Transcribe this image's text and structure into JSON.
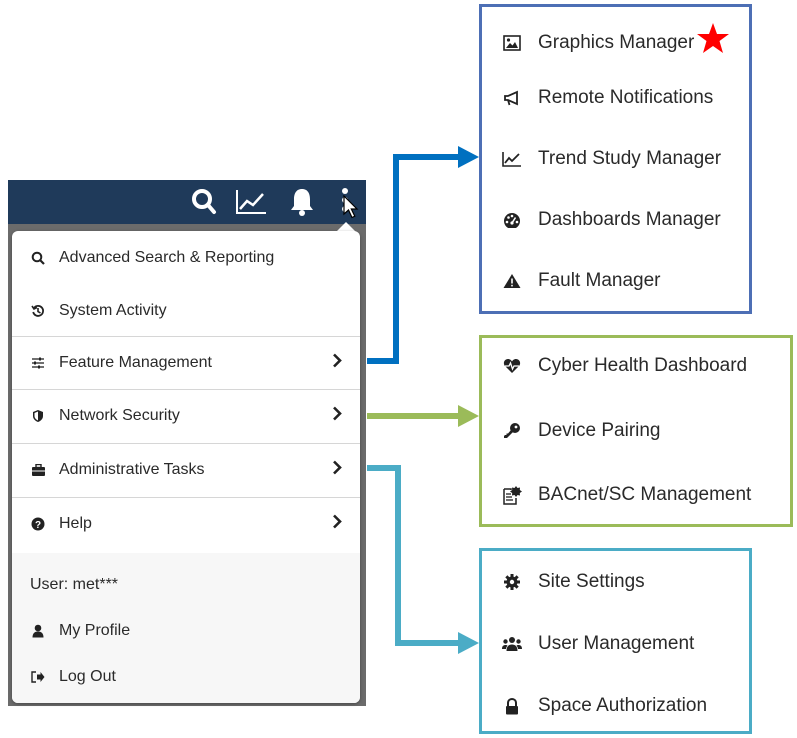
{
  "menu": {
    "items": [
      {
        "label": "Advanced Search & Reporting",
        "icon": "search-icon"
      },
      {
        "label": "System Activity",
        "icon": "history-icon"
      },
      {
        "label": "Feature Management",
        "icon": "sliders-icon",
        "has_submenu": true
      },
      {
        "label": "Network Security",
        "icon": "shield-icon",
        "has_submenu": true
      },
      {
        "label": "Administrative Tasks",
        "icon": "briefcase-icon",
        "has_submenu": true
      },
      {
        "label": "Help",
        "icon": "help-circle-icon",
        "has_submenu": true
      }
    ],
    "user_label": "User: met***",
    "profile": {
      "label": "My Profile",
      "icon": "user-icon"
    },
    "logout": {
      "label": "Log Out",
      "icon": "sign-out-icon"
    }
  },
  "feature_management_submenu": {
    "items": [
      {
        "label": "Graphics Manager",
        "icon": "image-icon",
        "starred": true
      },
      {
        "label": "Remote Notifications",
        "icon": "megaphone-icon"
      },
      {
        "label": "Trend Study Manager",
        "icon": "line-chart-icon"
      },
      {
        "label": "Dashboards Manager",
        "icon": "dashboard-icon"
      },
      {
        "label": "Fault Manager",
        "icon": "warning-icon"
      }
    ]
  },
  "network_security_submenu": {
    "items": [
      {
        "label": "Cyber Health Dashboard",
        "icon": "heartbeat-icon"
      },
      {
        "label": "Device Pairing",
        "icon": "key-icon"
      },
      {
        "label": "BACnet/SC Management",
        "icon": "certificate-icon"
      }
    ]
  },
  "administrative_tasks_submenu": {
    "items": [
      {
        "label": "Site Settings",
        "icon": "gear-icon"
      },
      {
        "label": "User Management",
        "icon": "users-icon"
      },
      {
        "label": "Space Authorization",
        "icon": "lock-icon"
      }
    ]
  },
  "colors": {
    "app_bar": "#1f3a5a",
    "feature_arrow": "#0070c0",
    "security_arrow": "#9bbb59",
    "admin_arrow": "#4bacc6",
    "blue_box": "#4d6fb5",
    "green_box": "#9bbb59",
    "teal_box": "#4bacc6",
    "star": "#ff0000"
  }
}
